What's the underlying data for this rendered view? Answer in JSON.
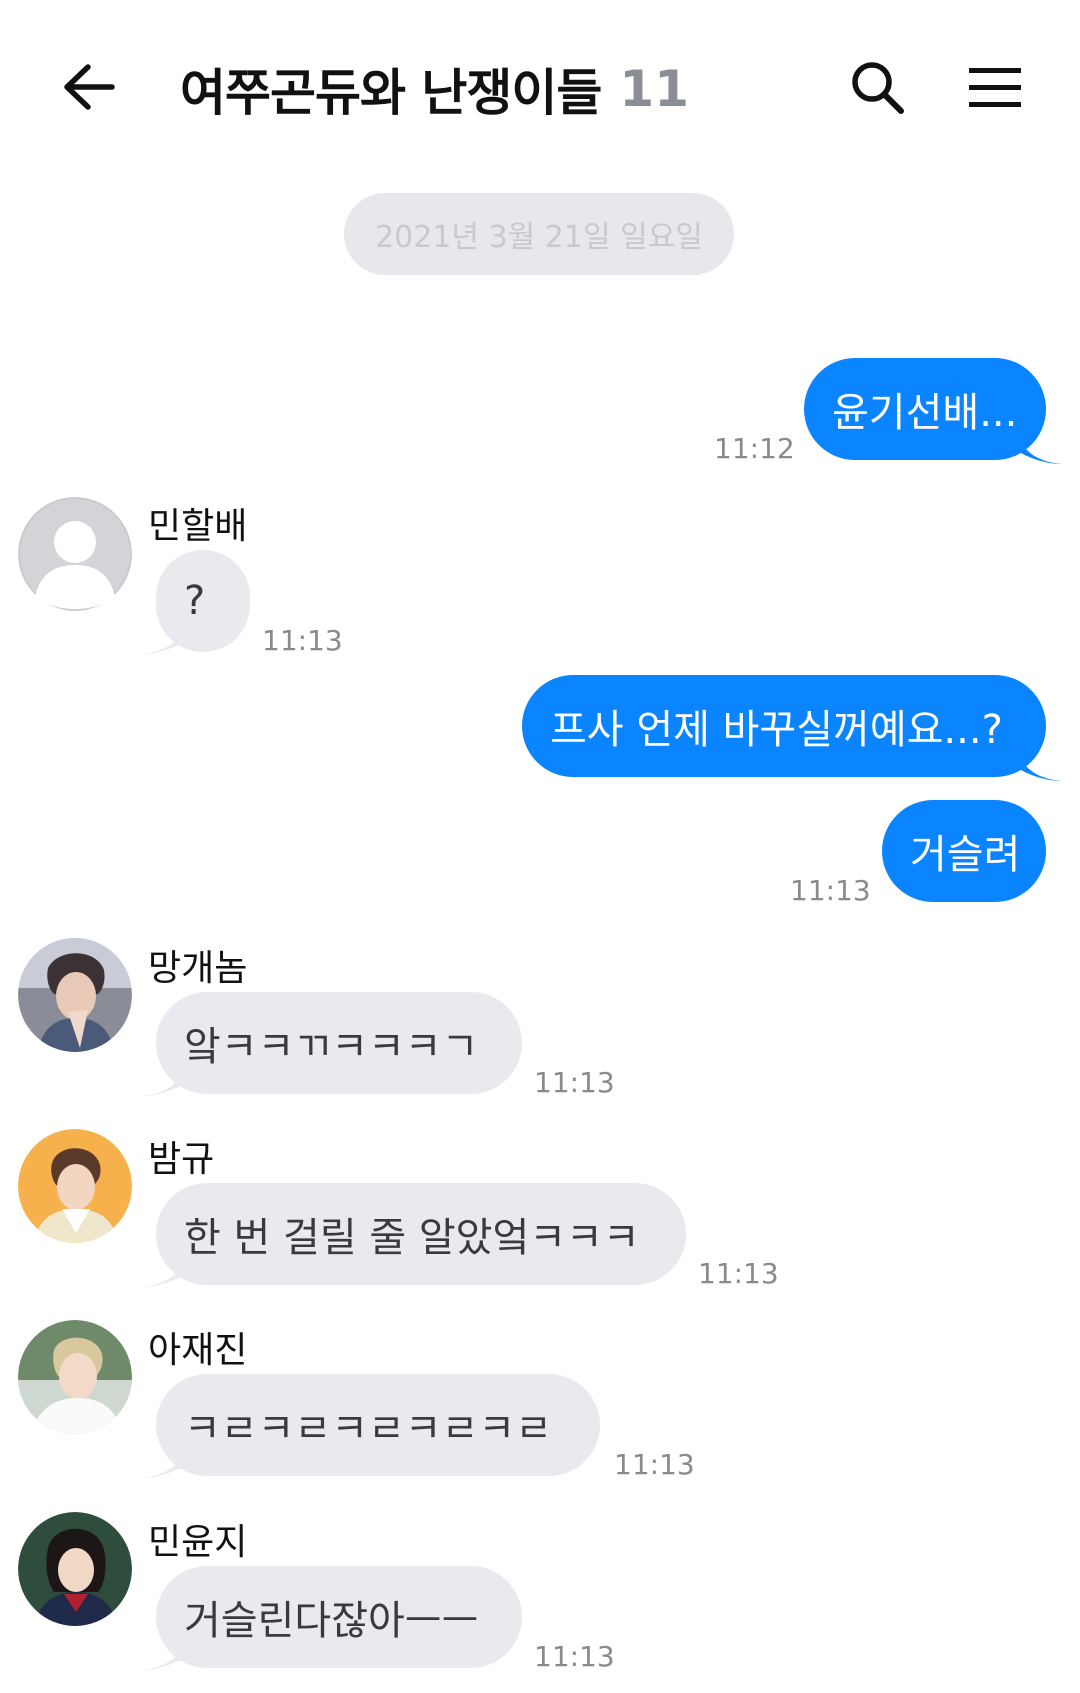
{
  "header": {
    "title": "여쭈곤듀와 난쟁이들",
    "member_count": "11"
  },
  "date_separator": "2021년 3월 21일 일요일",
  "messages": [
    {
      "text": "윤기선배...",
      "time": "11:12"
    },
    {
      "sender": "민할배",
      "text": "?",
      "time": "11:13"
    },
    {
      "text": "프사 언제 바꾸실꺼예요...?"
    },
    {
      "text": "거슬려",
      "time": "11:13"
    },
    {
      "sender": "망개놈",
      "text": "앜ㅋㅋㄲㅋㅋㅋㄱ",
      "time": "11:13"
    },
    {
      "sender": "밤규",
      "text": "한 번 걸릴 줄 알았엌ㅋㅋㅋ",
      "time": "11:13"
    },
    {
      "sender": "아재진",
      "text": "ㅋㄹㅋㄹㅋㄹㅋㄹㅋㄹ",
      "time": "11:13"
    },
    {
      "sender": "민윤지",
      "text": "거슬린다잖아ㅡㅡ",
      "time": "11:13"
    }
  ],
  "colors": {
    "outgoing_bubble": "#0a84ff",
    "incoming_bubble": "#e9e9ee",
    "date_pill": "#e7e8ec",
    "title_count": "#8a8f97"
  }
}
